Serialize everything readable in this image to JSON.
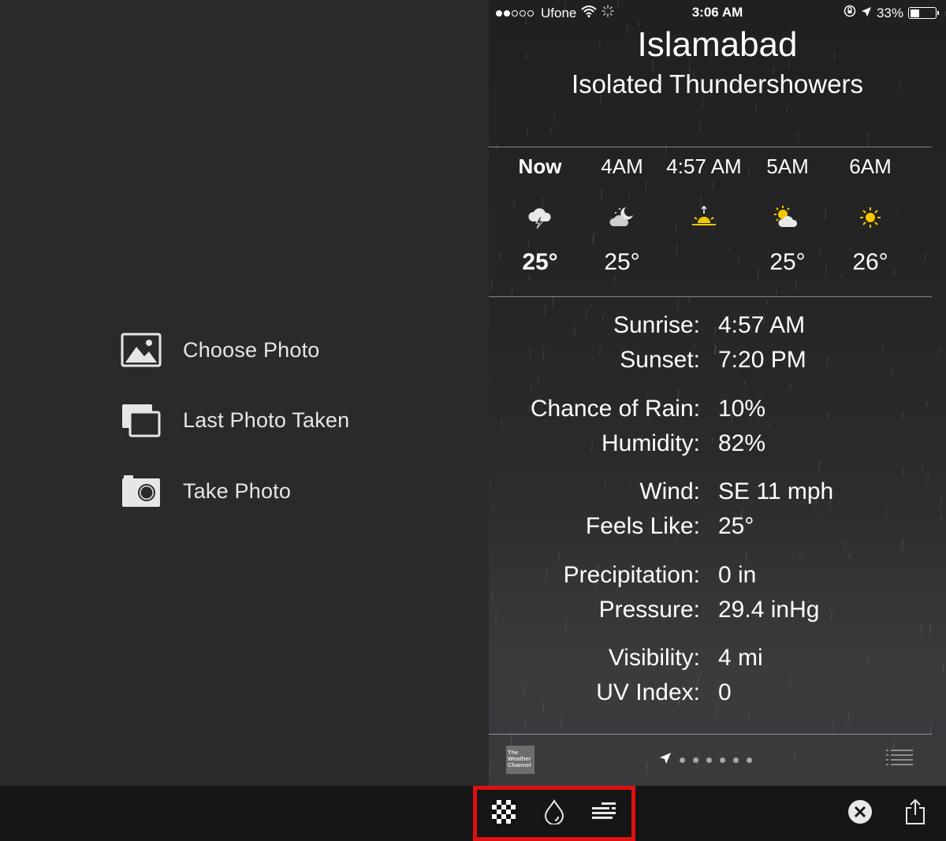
{
  "left_menu": {
    "items": [
      {
        "label": "Choose Photo",
        "icon": "photo-icon"
      },
      {
        "label": "Last Photo Taken",
        "icon": "stacked-photos-icon"
      },
      {
        "label": "Take Photo",
        "icon": "camera-icon"
      }
    ]
  },
  "status_bar": {
    "carrier": "Ufone",
    "time": "3:06 AM",
    "battery": "33%"
  },
  "weather": {
    "city": "Islamabad",
    "condition": "Isolated Thundershowers",
    "hourly": [
      {
        "time": "Now",
        "icon": "thunderstorm-cloud-icon",
        "temp": "25°"
      },
      {
        "time": "4AM",
        "icon": "partly-cloudy-night-icon",
        "temp": "25°"
      },
      {
        "time": "4:57 AM",
        "icon": "sunrise-icon",
        "temp": ""
      },
      {
        "time": "5AM",
        "icon": "partly-cloudy-day-icon",
        "temp": "25°"
      },
      {
        "time": "6AM",
        "icon": "sun-icon",
        "temp": "26°"
      }
    ],
    "details": [
      {
        "label": "Sunrise:",
        "value": "4:57 AM"
      },
      {
        "label": "Sunset:",
        "value": "7:20 PM"
      },
      {
        "label": "Chance of Rain:",
        "value": "10%"
      },
      {
        "label": "Humidity:",
        "value": "82%"
      },
      {
        "label": "Wind:",
        "value": "SE 11 mph"
      },
      {
        "label": "Feels Like:",
        "value": "25°"
      },
      {
        "label": "Precipitation:",
        "value": "0 in"
      },
      {
        "label": "Pressure:",
        "value": "29.4 inHg"
      },
      {
        "label": "Visibility:",
        "value": "4 mi"
      },
      {
        "label": "UV Index:",
        "value": "0"
      }
    ],
    "provider_logo_text": "The Weather Channel",
    "page_dots": 6
  },
  "toolbar": {
    "left_icons": [
      "checkerboard-icon",
      "water-drop-icon",
      "text-align-icon"
    ],
    "right_icons": [
      "close-circle-icon",
      "share-icon"
    ],
    "highlight_color": "#e01010"
  }
}
